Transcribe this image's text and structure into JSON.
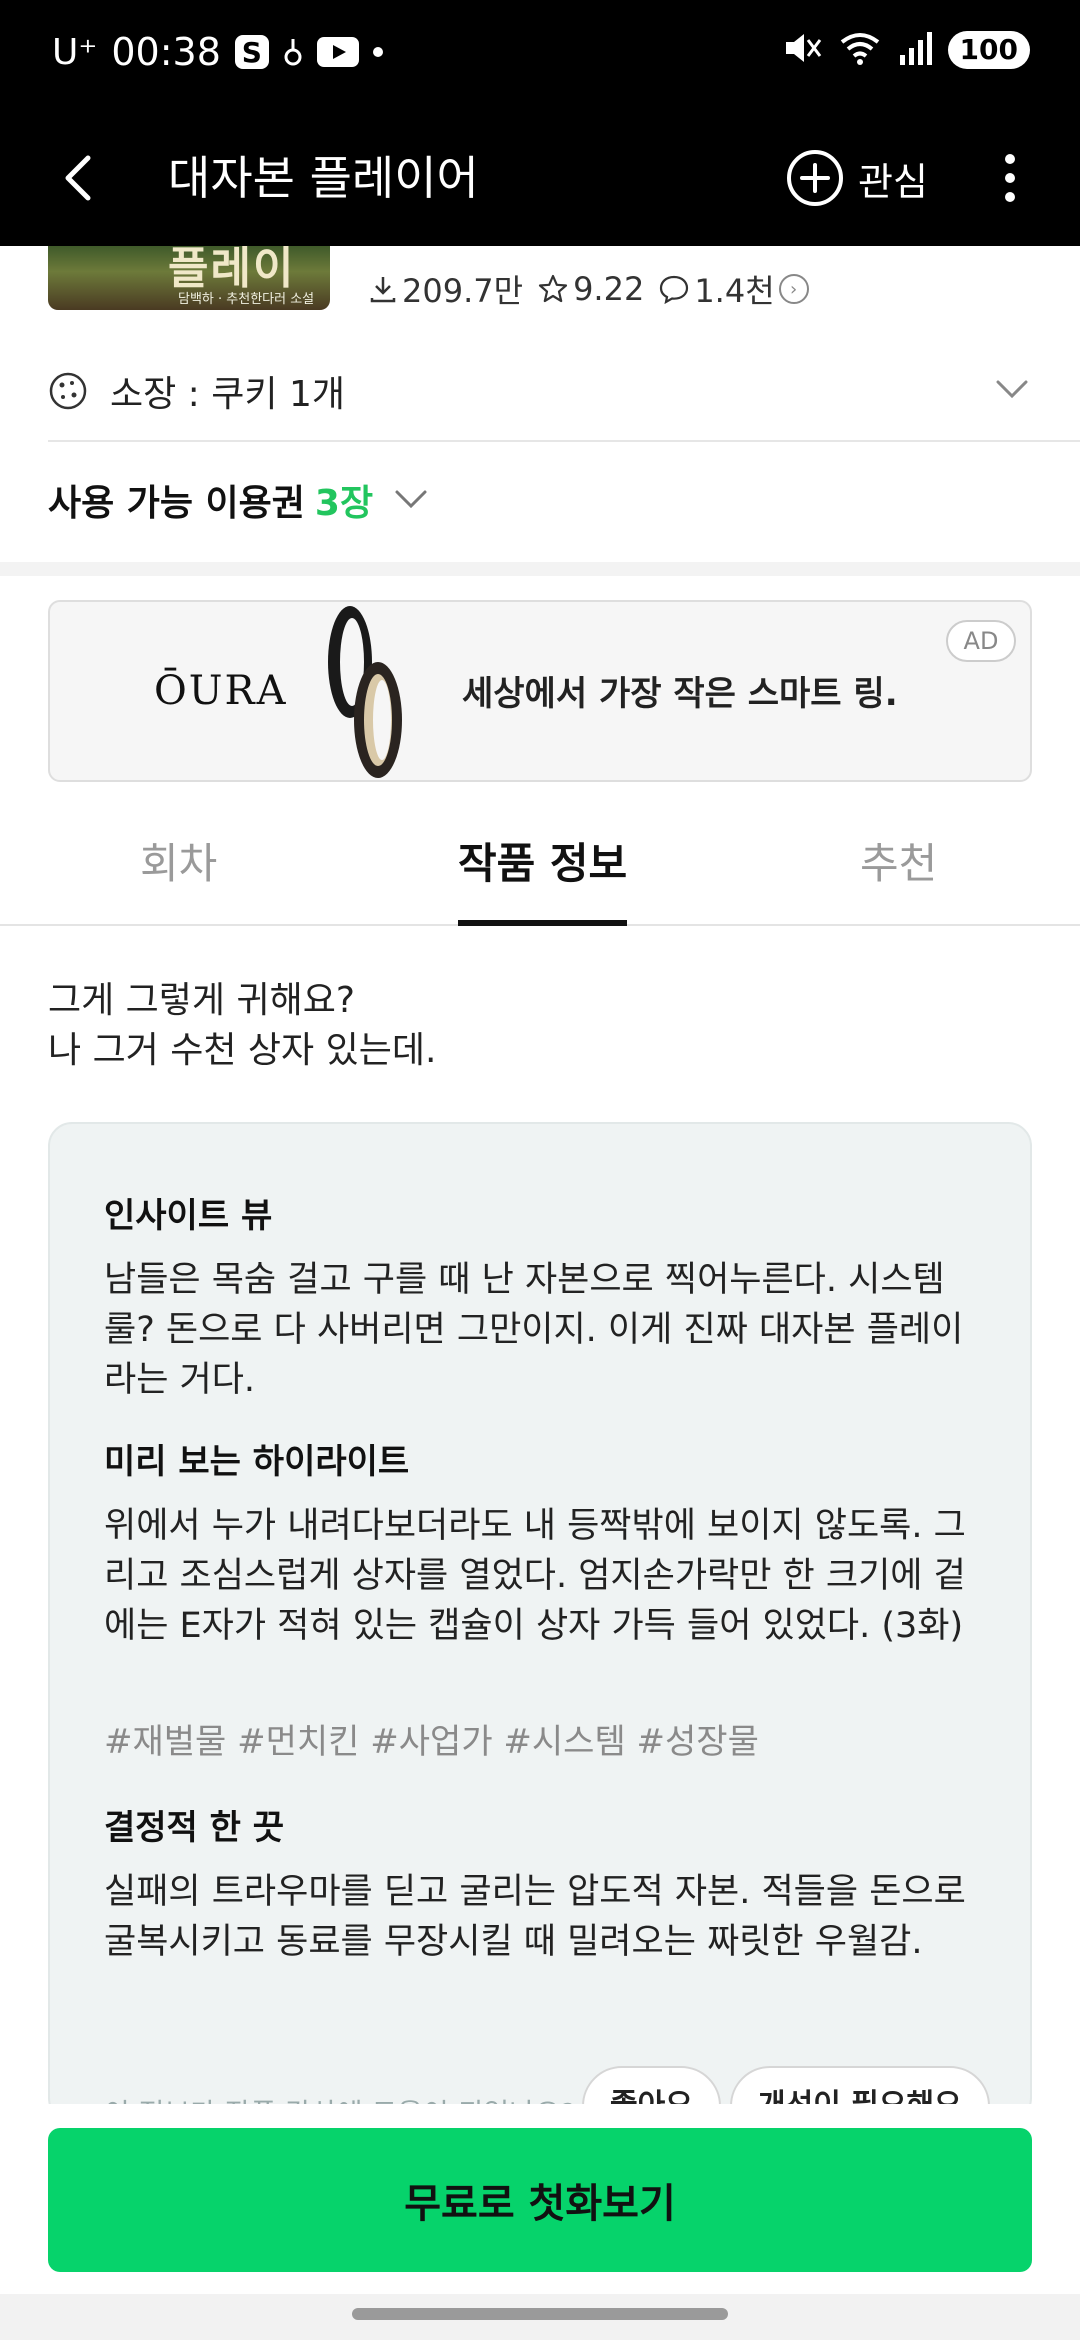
{
  "status_bar": {
    "carrier": "U⁺",
    "time": "00:38",
    "s_badge": "S",
    "battery": "100"
  },
  "app_bar": {
    "title": "대자본 플레이어",
    "favorite_label": "관심"
  },
  "cover": {
    "title_fragment": "플레이",
    "author_fragment": "담백하 · 추천한다러 소설"
  },
  "stats": {
    "downloads": "209.7만",
    "rating": "9.22",
    "comments": "1.4천"
  },
  "owned": {
    "label": "소장 : 쿠키 1개"
  },
  "tickets": {
    "label": "사용 가능 이용권",
    "count": "3장"
  },
  "ad": {
    "brand": "ŌURA",
    "text": "세상에서 가장 작은 스마트 링.",
    "badge": "AD"
  },
  "tabs": [
    {
      "label": "회차",
      "active": false
    },
    {
      "label": "작품 정보",
      "active": true
    },
    {
      "label": "추천",
      "active": false
    }
  ],
  "synopsis": {
    "line1": "그게 그렇게 귀해요?",
    "line2": "나 그거 수천 상자 있는데."
  },
  "info_card": {
    "insight_title": "인사이트 뷰",
    "insight_body": "남들은 목숨 걸고 구를 때 난 자본으로 찍어누른다. 시스템 룰? 돈으로 다 사버리면 그만이지. 이게 진짜 대자본 플레이라는 거다.",
    "highlight_title": "미리 보는 하이라이트",
    "highlight_body": "위에서 누가 내려다보더라도 내 등짝밖에 보이지 않도록. 그리고 조심스럽게 상자를 열었다. 엄지손가락만 한 크기에 겉에는 E자가 적혀 있는 캡슐이 상자 가득 들어 있었다. (3화)",
    "hashtags": "#재벌물 #먼치킨 #사업가 #시스템 #성장물",
    "decisive_title": "결정적 한 끗",
    "decisive_body": "실패의 트라우마를 딛고 굴리는 압도적 자본. 적들을 돈으로 굴복시키고 동료를 무장시킬 때 밀려오는 짜릿한 우월감.",
    "cut_text": "이 정보가 작품 감상에 도움이 되었나요?",
    "cut_btn1": "좋아요",
    "cut_btn2": "개선이 필요해요"
  },
  "cta": {
    "label": "무료로 첫화보기"
  },
  "colors": {
    "accent_green": "#06d36b",
    "ticket_count": "#22c55e",
    "header_bg": "#000000"
  }
}
